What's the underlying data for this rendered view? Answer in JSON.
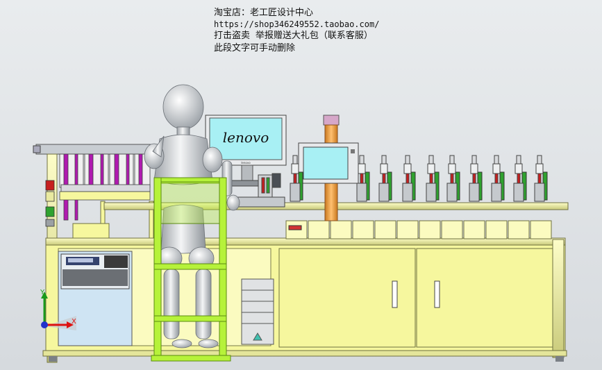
{
  "watermark": {
    "line1": "淘宝店：老工匠设计中心",
    "line2": "https://shop346249552.taobao.com/",
    "line3": "打击盗卖 举报赠送大礼包（联系客服）",
    "line4": "此段文字可手动删除"
  },
  "monitor": {
    "brand": "lenovo",
    "bezel_brand": "lenovo"
  },
  "axes": {
    "x_label": "X",
    "y_label": "Y"
  },
  "colors": {
    "frame": "#f6f79e",
    "frame_edge": "#6f7040",
    "screen": "#a8f0f4",
    "chair": "#b6f23a",
    "mannequin": "#d9dcdf",
    "accent_magenta": "#b01ab0",
    "pipe_orange": "#f0a040"
  }
}
